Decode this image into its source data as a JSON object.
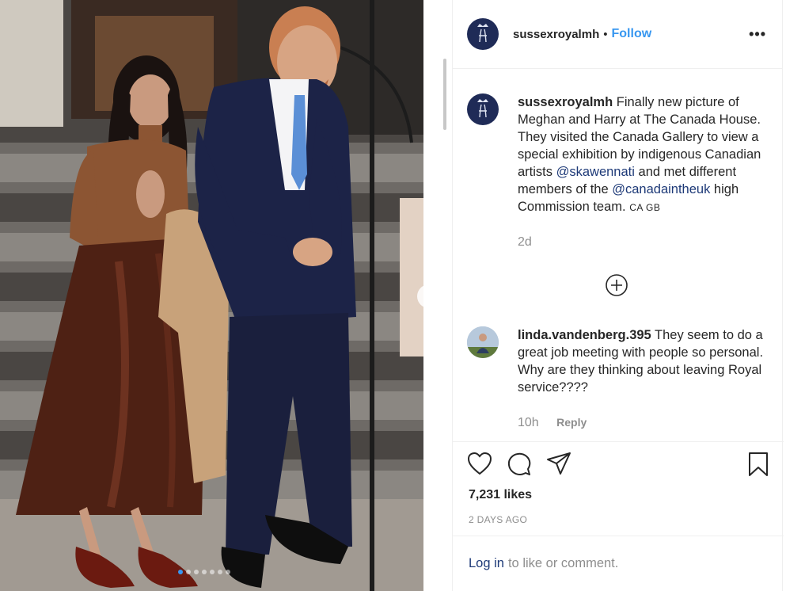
{
  "post": {
    "username": "sussexroyalmh",
    "separator": "•",
    "follow_label": "Follow",
    "more_label": "•••"
  },
  "caption": {
    "username": "sussexroyalmh",
    "text_before_mention1": "Finally new picture of Meghan and Harry at The Canada House. They visited the Canada Gallery to view a special exhibition by indigenous Canadian artists",
    "mention1": "@skawennati",
    "text_between": "and met different members of the",
    "mention2": "@canadaintheuk",
    "text_after": "high Commission team.",
    "flags": "CA GB",
    "age": "2d"
  },
  "comment": {
    "username": "linda.vandenberg.395",
    "text": "They seem to do a great job meeting with people so personal. Why are they thinking about leaving Royal service????",
    "age": "10h",
    "reply_label": "Reply"
  },
  "engagement": {
    "likes": "7,231 likes",
    "time": "2 DAYS AGO"
  },
  "login": {
    "link_label": "Log in",
    "suffix": "to like or comment."
  },
  "carousel": {
    "total": 7,
    "active_index": 0
  },
  "icons": {
    "like": "heart-icon",
    "comment": "comment-icon",
    "share": "paper-plane-icon",
    "save": "bookmark-icon",
    "expand": "plus-circle-icon",
    "next": "chevron-right-icon"
  },
  "colors": {
    "link_blue": "#3897f0",
    "mention": "#1e3a78",
    "muted": "#8e8e8e",
    "avatar_bg": "#1f2b57"
  }
}
